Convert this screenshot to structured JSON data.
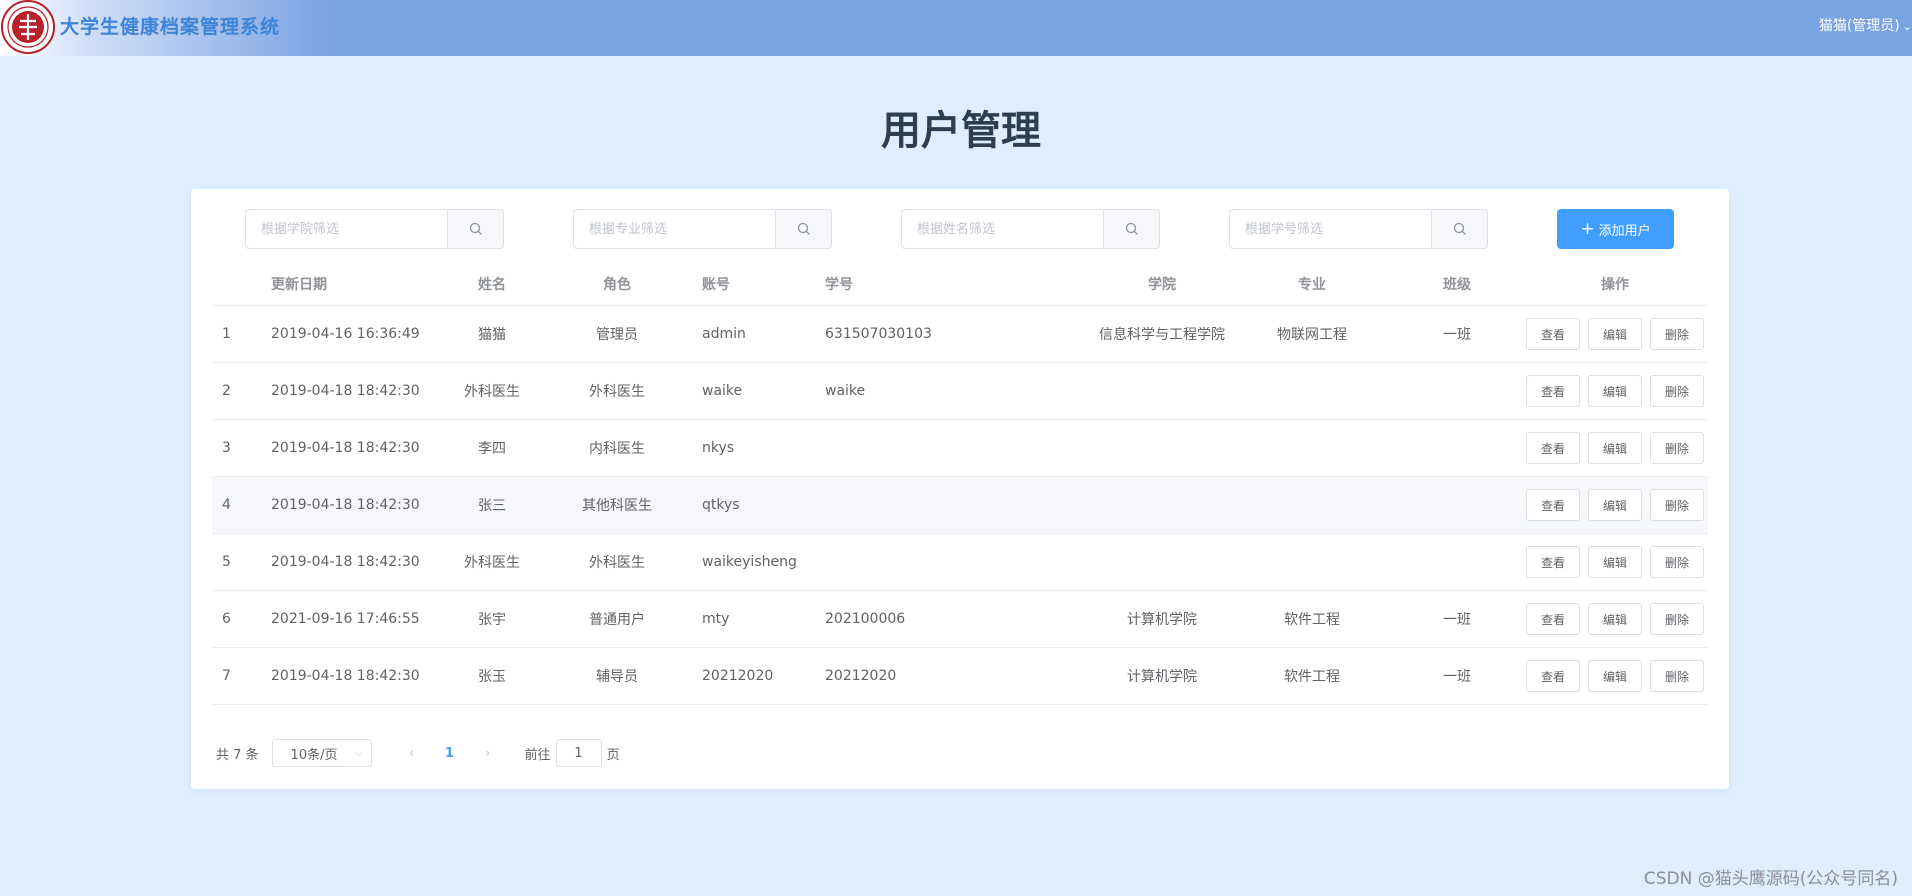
{
  "header": {
    "app_title": "大学生健康档案管理系统",
    "user_label": "猫猫(管理员)",
    "logo_icon": "university-seal-icon",
    "brand_color": "#3d83d6",
    "bar_color": "#7aa3e2"
  },
  "page": {
    "title": "用户管理"
  },
  "filters": [
    {
      "placeholder": "根据学院筛选",
      "value": ""
    },
    {
      "placeholder": "根据专业筛选",
      "value": ""
    },
    {
      "placeholder": "根据姓名筛选",
      "value": ""
    },
    {
      "placeholder": "根据学号筛选",
      "value": ""
    }
  ],
  "add_button": {
    "label": "添加用户",
    "color": "#409eff"
  },
  "table": {
    "columns": [
      "更新日期",
      "姓名",
      "角色",
      "账号",
      "学号",
      "学院",
      "专业",
      "班级",
      "操作"
    ],
    "actions": [
      "查看",
      "编辑",
      "删除"
    ],
    "rows": [
      {
        "index": "1",
        "date": "2019-04-16 16:36:49",
        "name": "猫猫",
        "role": "管理员",
        "account": "admin",
        "student_no": "631507030103",
        "college": "信息科学与工程学院",
        "major": "物联网工程",
        "class": "一班"
      },
      {
        "index": "2",
        "date": "2019-04-18 18:42:30",
        "name": "外科医生",
        "role": "外科医生",
        "account": "waike",
        "student_no": "waike",
        "college": "",
        "major": "",
        "class": ""
      },
      {
        "index": "3",
        "date": "2019-04-18 18:42:30",
        "name": "李四",
        "role": "内科医生",
        "account": "nkys",
        "student_no": "",
        "college": "",
        "major": "",
        "class": ""
      },
      {
        "index": "4",
        "date": "2019-04-18 18:42:30",
        "name": "张三",
        "role": "其他科医生",
        "account": "qtkys",
        "student_no": "",
        "college": "",
        "major": "",
        "class": ""
      },
      {
        "index": "5",
        "date": "2019-04-18 18:42:30",
        "name": "外科医生",
        "role": "外科医生",
        "account": "waikeyisheng",
        "student_no": "",
        "college": "",
        "major": "",
        "class": ""
      },
      {
        "index": "6",
        "date": "2021-09-16 17:46:55",
        "name": "张宇",
        "role": "普通用户",
        "account": "mty",
        "student_no": "202100006",
        "college": "计算机学院",
        "major": "软件工程",
        "class": "一班"
      },
      {
        "index": "7",
        "date": "2019-04-18 18:42:30",
        "name": "张玉",
        "role": "辅导员",
        "account": "20212020",
        "student_no": "20212020",
        "college": "计算机学院",
        "major": "软件工程",
        "class": "一班"
      }
    ]
  },
  "pagination": {
    "total_label": "共 7 条",
    "page_size": "10条/页",
    "current_page": "1",
    "goto_prefix": "前往",
    "goto_value": "1",
    "goto_suffix": "页",
    "accent_color": "#409eff"
  },
  "watermark": "CSDN @猫头鹰源码(公众号同名)"
}
